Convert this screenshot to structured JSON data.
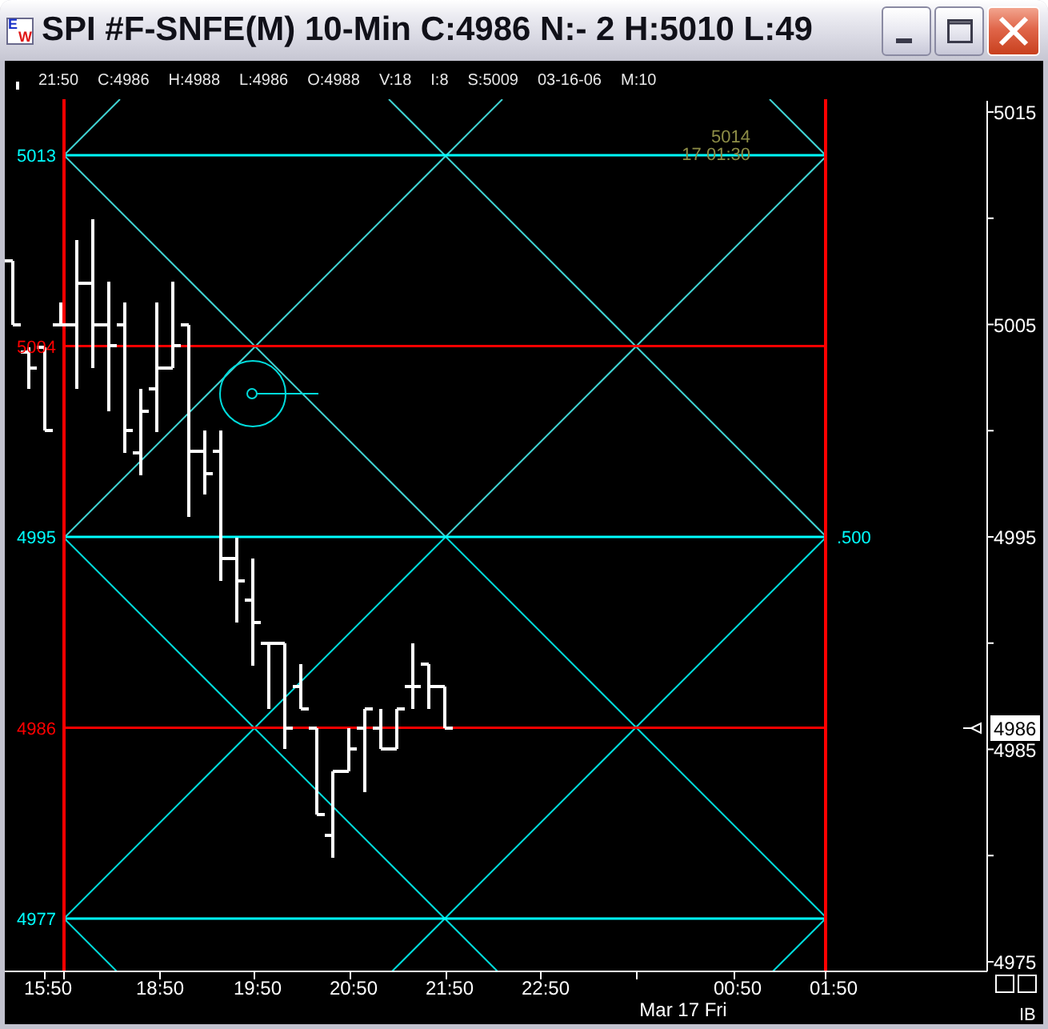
{
  "window": {
    "title": "SPI #F-SNFE(M) 10-Min C:4986 N:- 2 H:5010 L:49",
    "icon_letters": [
      {
        "text": "E",
        "color": "#1830c8"
      },
      {
        "text": "W",
        "color": "#e01818"
      }
    ]
  },
  "info_bar": [
    "21:50",
    "C:4986",
    "H:4988",
    "L:4986",
    "O:4988",
    "V:18",
    "I:8",
    "S:5009",
    "03-16-06",
    "M:10"
  ],
  "chart": {
    "levels": [
      {
        "label": "5013",
        "color": "#00ffff"
      },
      {
        "label": "5004",
        "color": "#ff0000"
      },
      {
        "label": "4995",
        "color": "#00ffff",
        "ratio": ".500"
      },
      {
        "label": "4986",
        "color": "#ff0000"
      },
      {
        "label": "4977",
        "color": "#00ffff"
      }
    ],
    "annotation": {
      "price": "5014",
      "time": "17 01:30"
    },
    "price_axis": {
      "labels": [
        "5015",
        "5005",
        "4995",
        "4985",
        "4975"
      ],
      "current": "4986"
    },
    "time_axis": {
      "labels": [
        "15:50",
        "18:50",
        "19:50",
        "20:50",
        "21:50",
        "22:50",
        "00:50",
        "01:50"
      ],
      "date": "Mar 17 Fri"
    },
    "corner_label": "IB"
  }
}
